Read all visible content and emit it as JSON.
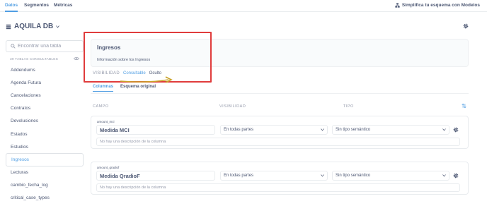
{
  "nav": {
    "tabs": [
      {
        "label": "Datos"
      },
      {
        "label": "Segmentos"
      },
      {
        "label": "Métricas"
      }
    ],
    "right_action": "Simplifica tu esquema con Modelos"
  },
  "database": {
    "name": "AQUILA DB"
  },
  "sidebar": {
    "search_placeholder": "Encontrar una tabla",
    "caption": "39 TABLAS CONSULTABLES",
    "items": [
      {
        "label": "Addendums"
      },
      {
        "label": "Agenda Futura"
      },
      {
        "label": "Cancelaciones"
      },
      {
        "label": "Contratos"
      },
      {
        "label": "Devoluciones"
      },
      {
        "label": "Estados"
      },
      {
        "label": "Estudios"
      },
      {
        "label": "Ingresos"
      },
      {
        "label": "Lecturas"
      },
      {
        "label": "cambio_fecha_log"
      },
      {
        "label": "critical_case_types"
      }
    ]
  },
  "table": {
    "title": "Ingresos",
    "description": "Información sobre los Ingresos",
    "visibility_label": "VISIBILIDAD",
    "visibility_options": [
      {
        "label": "Consultable"
      },
      {
        "label": "Oculto"
      }
    ]
  },
  "subtabs": [
    {
      "label": "Columnas"
    },
    {
      "label": "Esquema original"
    }
  ],
  "columns_header": {
    "field": "CAMPO",
    "visibility": "VISIBILIDAD",
    "type": "TIPO"
  },
  "fields": [
    {
      "id": "amount_mci",
      "display_name": "Medida MCI",
      "visibility": "En todas partes",
      "semantic_type": "Sin tipo semántico",
      "description_placeholder": "No hay una descripción de la columna"
    },
    {
      "id": "amount_qradiof",
      "display_name": "Medida QradioF",
      "visibility": "En todas partes",
      "semantic_type": "Sin tipo semántico",
      "description_placeholder": "No hay una descripción de la columna"
    }
  ],
  "colors": {
    "accent": "#509ee3",
    "highlight_border": "#e03c3c",
    "annotation_arrow": "#c9a227",
    "text": "#4c5773",
    "muted": "#949aab"
  }
}
